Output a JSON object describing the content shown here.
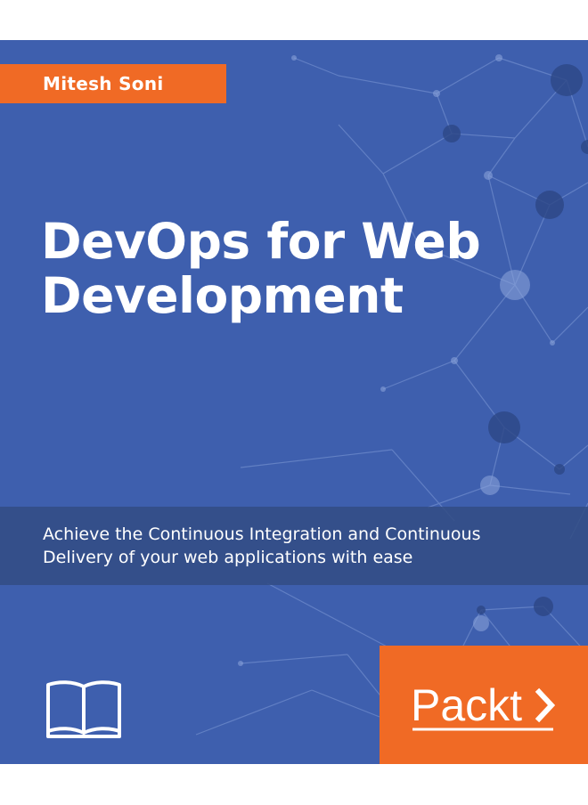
{
  "cover": {
    "author": "Mitesh Soni",
    "title_lines": [
      "DevOps for Web",
      "Development"
    ],
    "subtitle_lines": [
      "Achieve the Continuous Integration and Continuous",
      "Delivery of your web applications with ease"
    ],
    "publisher": "Packt",
    "icons": {
      "book": "open-book-icon",
      "publisher_arrow": "chevron-right-icon"
    }
  },
  "colors": {
    "background": "#3e5fae",
    "author_bar": "#f06a25",
    "subtitle_band": "#3a5591",
    "publisher_box": "#f06a25",
    "text": "#ffffff"
  }
}
